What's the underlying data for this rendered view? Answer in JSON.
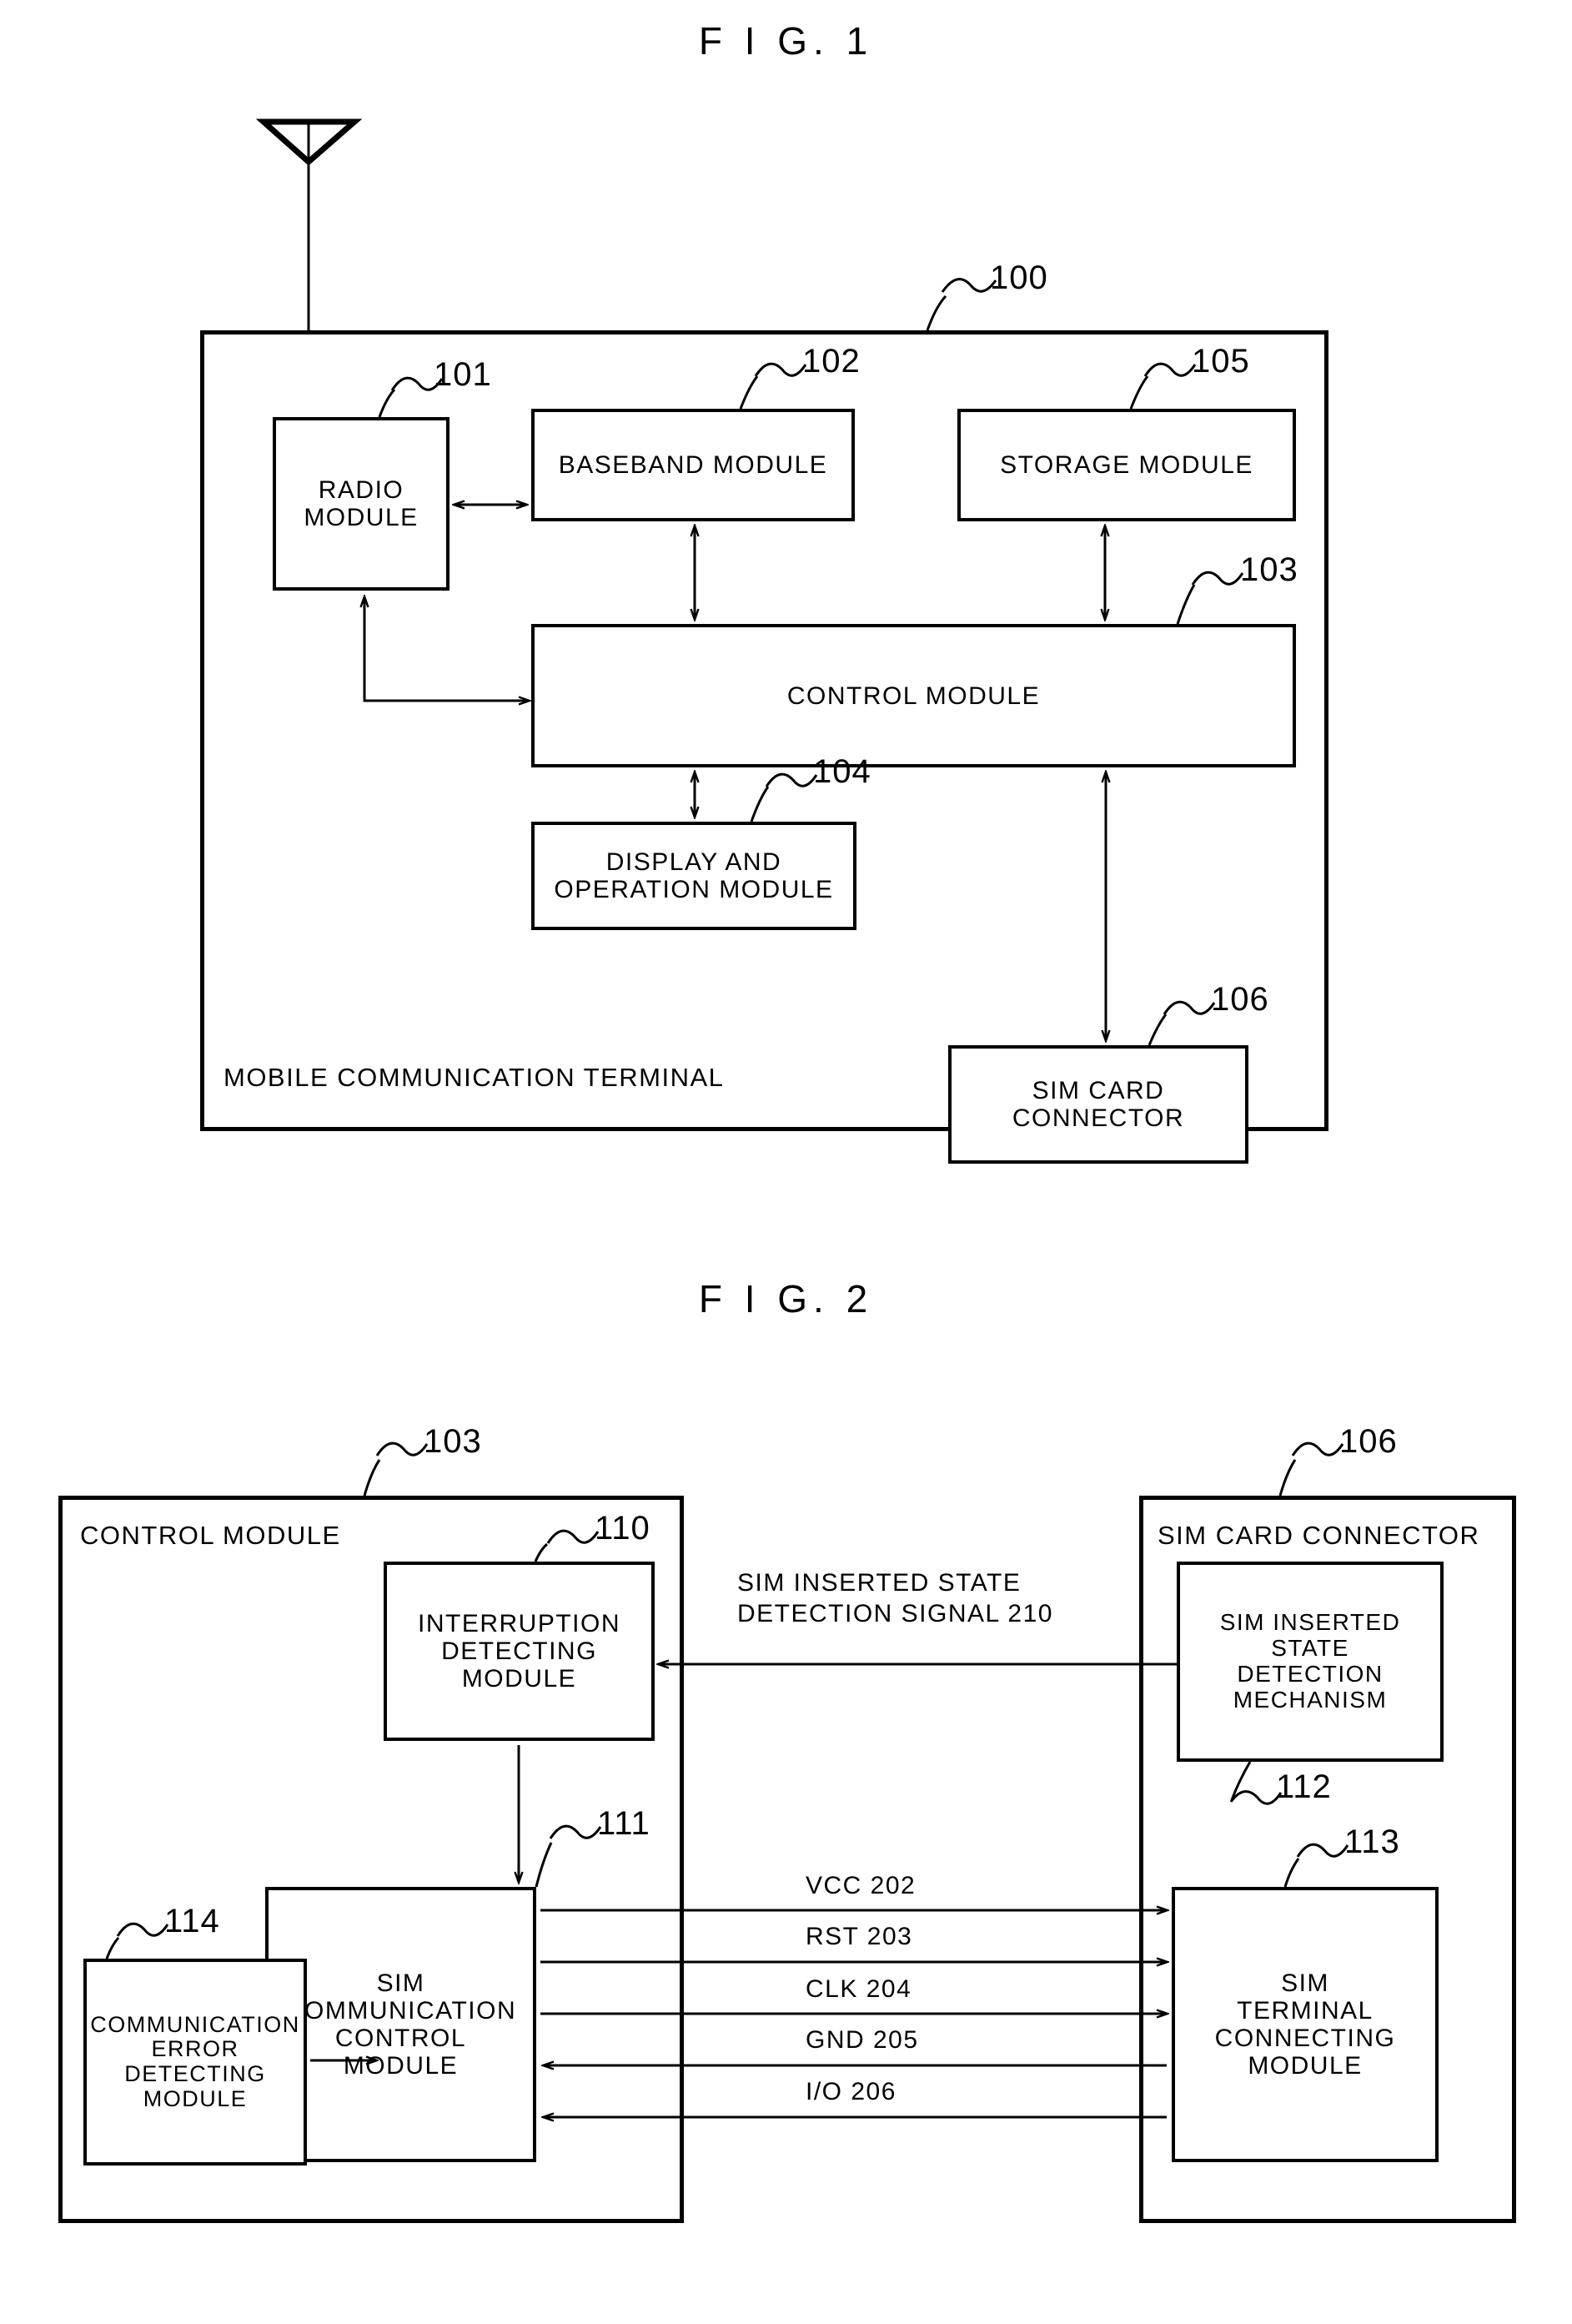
{
  "figures": [
    {
      "title": "F I G.  1",
      "outer_label": "MOBILE COMMUNICATION TERMINAL",
      "outer_ref": "100",
      "blocks": [
        {
          "ref": "101",
          "label": "RADIO\nMODULE"
        },
        {
          "ref": "102",
          "label": "BASEBAND MODULE"
        },
        {
          "ref": "105",
          "label": "STORAGE MODULE"
        },
        {
          "ref": "103",
          "label": "CONTROL MODULE"
        },
        {
          "ref": "104",
          "label": "DISPLAY AND\nOPERATION MODULE"
        },
        {
          "ref": "106",
          "label": "SIM CARD\nCONNECTOR"
        }
      ],
      "antenna": "antenna-symbol"
    },
    {
      "title": "F I G.  2",
      "left_container": {
        "ref": "103",
        "label": "CONTROL MODULE"
      },
      "right_container": {
        "ref": "106",
        "label": "SIM CARD CONNECTOR"
      },
      "blocks": [
        {
          "ref": "110",
          "label": "INTERRUPTION\nDETECTING\nMODULE"
        },
        {
          "ref": "111",
          "label": "SIM\nCOMMUNICATION\nCONTROL\nMODULE"
        },
        {
          "ref": "114",
          "label": "COMMUNICATION\nERROR\nDETECTING\nMODULE"
        },
        {
          "ref": "112",
          "label": "SIM INSERTED\nSTATE\nDETECTION\nMECHANISM"
        },
        {
          "ref": "113",
          "label": "SIM\nTERMINAL\nCONNECTING\nMODULE"
        }
      ],
      "signal_label": "SIM INSERTED STATE\nDETECTION SIGNAL 210",
      "bus_signals": [
        {
          "name": "VCC 202"
        },
        {
          "name": "RST 203"
        },
        {
          "name": "CLK 204"
        },
        {
          "name": "GND 205"
        },
        {
          "name": "I/O 206"
        }
      ]
    }
  ]
}
